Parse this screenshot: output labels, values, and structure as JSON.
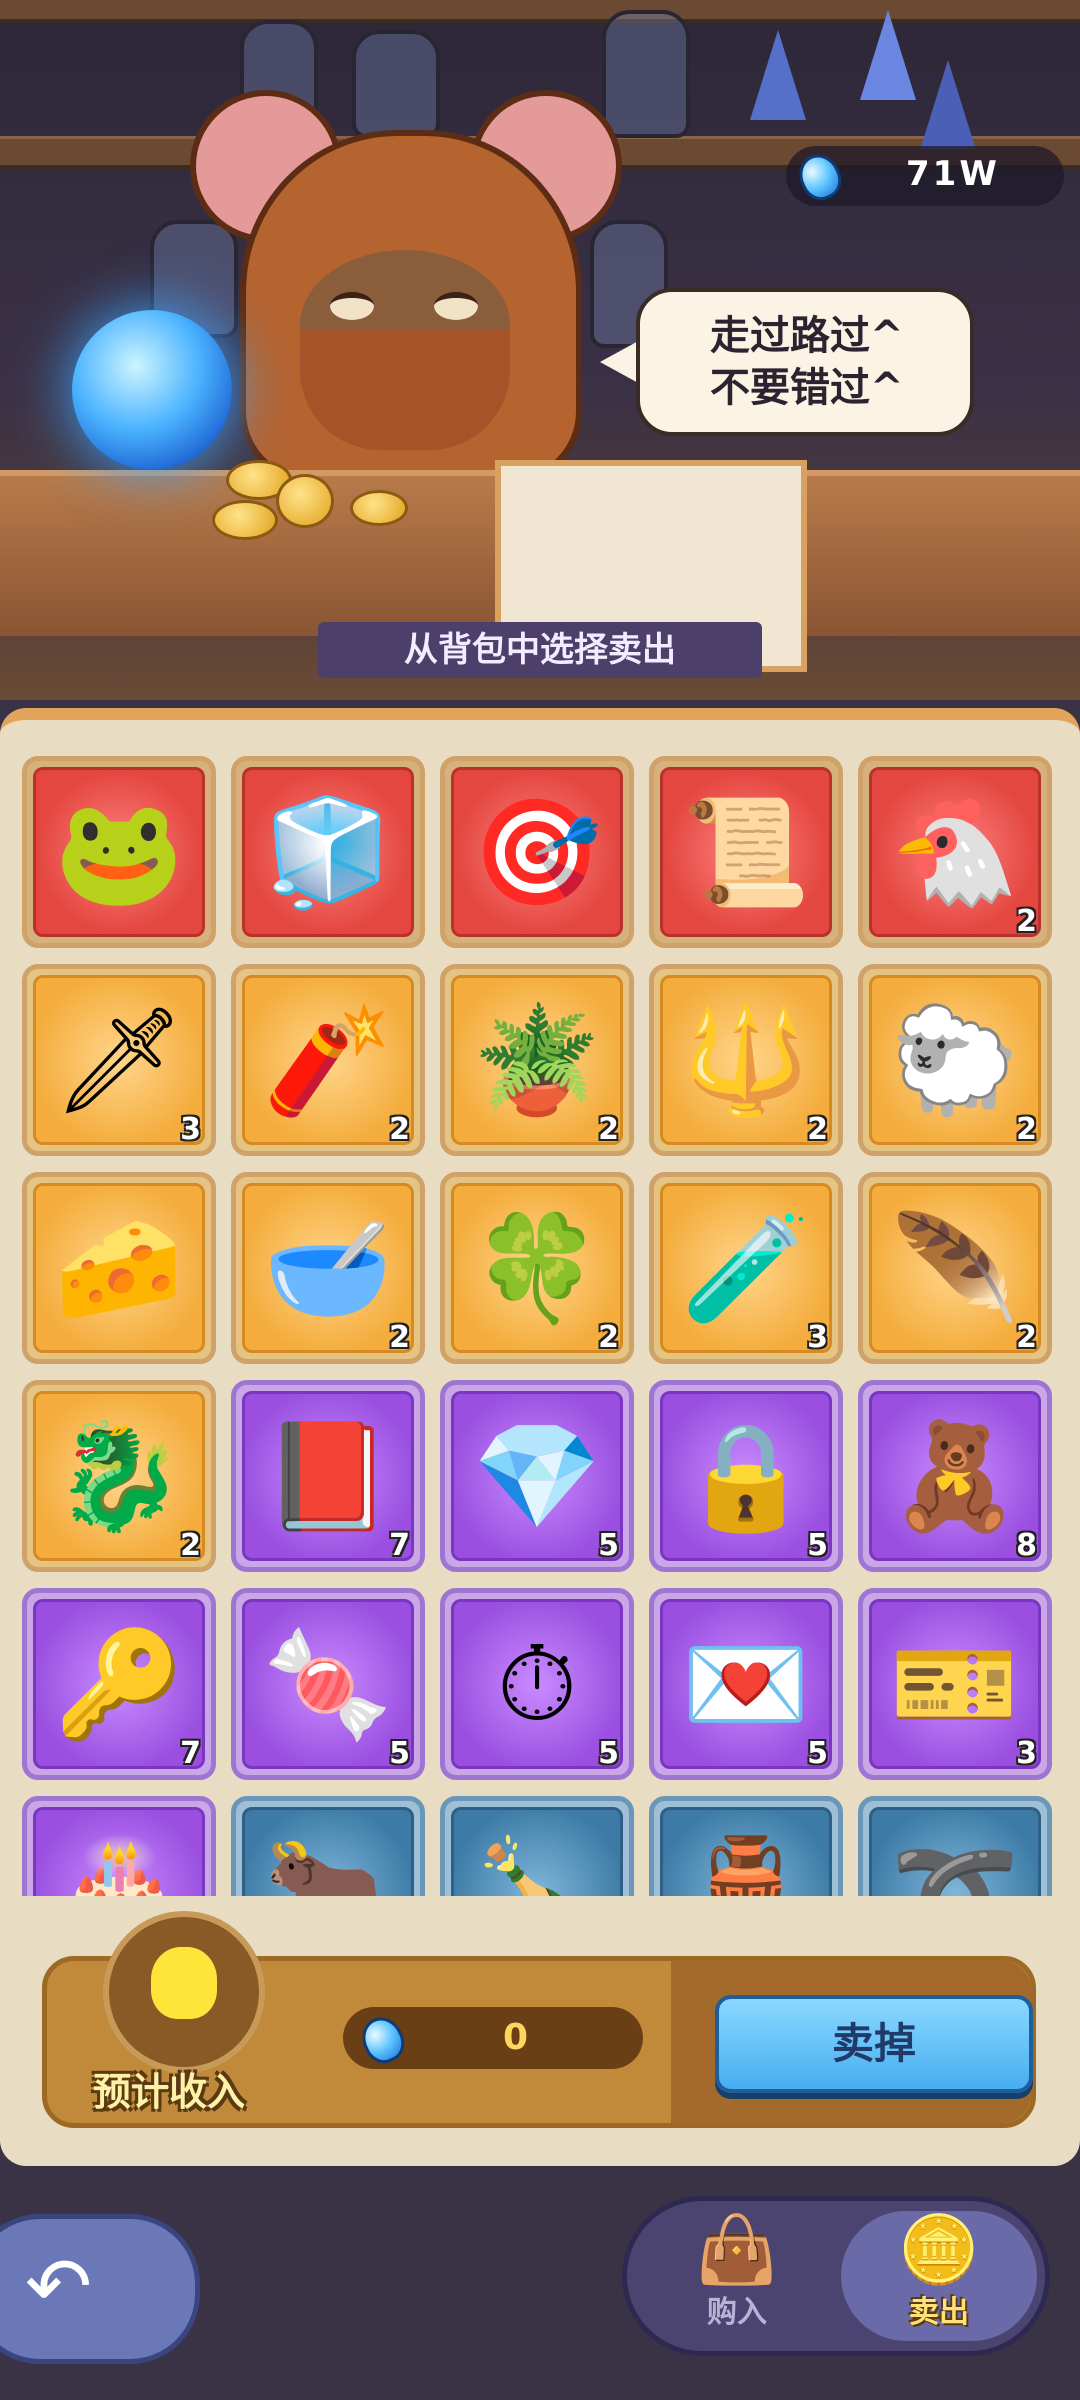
{
  "currency": {
    "amount": "71W",
    "icon": "blue-gem-icon"
  },
  "speech_bubble": {
    "text": "走过路过^\n不要错过^"
  },
  "section_title": "从背包中选择卖出",
  "inventory": [
    {
      "name": "frog-orb",
      "glyph": "🐸",
      "rarity": "red",
      "qty": ""
    },
    {
      "name": "ice-cube",
      "glyph": "🧊",
      "rarity": "red",
      "qty": ""
    },
    {
      "name": "golden-target",
      "glyph": "🎯",
      "rarity": "red",
      "qty": ""
    },
    {
      "name": "scroll",
      "glyph": "📜",
      "rarity": "red",
      "qty": ""
    },
    {
      "name": "chicken",
      "glyph": "🐔",
      "rarity": "red",
      "qty": "2"
    },
    {
      "name": "dagger",
      "glyph": "🗡",
      "rarity": "gold",
      "qty": "3"
    },
    {
      "name": "cannon",
      "glyph": "🧨",
      "rarity": "gold",
      "qty": "2"
    },
    {
      "name": "terrarium-box",
      "glyph": "🪴",
      "rarity": "gold",
      "qty": "2"
    },
    {
      "name": "trident",
      "glyph": "🔱",
      "rarity": "gold",
      "qty": "2"
    },
    {
      "name": "golden-sheep",
      "glyph": "🐑",
      "rarity": "gold",
      "qty": "2"
    },
    {
      "name": "cheese",
      "glyph": "🧀",
      "rarity": "gold",
      "qty": ""
    },
    {
      "name": "pot",
      "glyph": "🥣",
      "rarity": "gold",
      "qty": "2"
    },
    {
      "name": "clover-coin",
      "glyph": "🍀",
      "rarity": "gold",
      "qty": "2"
    },
    {
      "name": "star-potion",
      "glyph": "🧪",
      "rarity": "gold",
      "qty": "3"
    },
    {
      "name": "golden-feather",
      "glyph": "🪶",
      "rarity": "gold",
      "qty": "2"
    },
    {
      "name": "golden-dragon",
      "glyph": "🐉",
      "rarity": "gold",
      "qty": "2"
    },
    {
      "name": "red-book",
      "glyph": "📕",
      "rarity": "purple",
      "qty": "7"
    },
    {
      "name": "gemstone",
      "glyph": "💎",
      "rarity": "purple",
      "qty": "5"
    },
    {
      "name": "chained-lock",
      "glyph": "🔒",
      "rarity": "purple",
      "qty": "5"
    },
    {
      "name": "teddy-bear",
      "glyph": "🧸",
      "rarity": "purple",
      "qty": "8"
    },
    {
      "name": "key",
      "glyph": "🔑",
      "rarity": "purple",
      "qty": "7"
    },
    {
      "name": "candy",
      "glyph": "🍬",
      "rarity": "purple",
      "qty": "5"
    },
    {
      "name": "stopwatch",
      "glyph": "⏱",
      "rarity": "purple",
      "qty": "5"
    },
    {
      "name": "love-letter",
      "glyph": "💌",
      "rarity": "purple",
      "qty": "5"
    },
    {
      "name": "vip-ticket",
      "glyph": "🎫",
      "rarity": "purple",
      "qty": "3"
    },
    {
      "name": "cake",
      "glyph": "🎂",
      "rarity": "purple",
      "qty": ""
    },
    {
      "name": "bull",
      "glyph": "🐂",
      "rarity": "blue",
      "qty": ""
    },
    {
      "name": "bottle",
      "glyph": "🍾",
      "rarity": "blue",
      "qty": ""
    },
    {
      "name": "jar",
      "glyph": "🏺",
      "rarity": "blue",
      "qty": ""
    },
    {
      "name": "keyring",
      "glyph": "➰",
      "rarity": "blue",
      "qty": ""
    }
  ],
  "income": {
    "label": "预计收入",
    "value": "0",
    "sell_button": "卖掉"
  },
  "nav": {
    "buy_label": "购入",
    "sell_label": "卖出",
    "active": "sell"
  },
  "colors": {
    "red": "#e3473f",
    "gold": "#f4ac3c",
    "purple": "#9a4fe0",
    "blue": "#3d7ba6",
    "sell_button": "#47aef0"
  }
}
